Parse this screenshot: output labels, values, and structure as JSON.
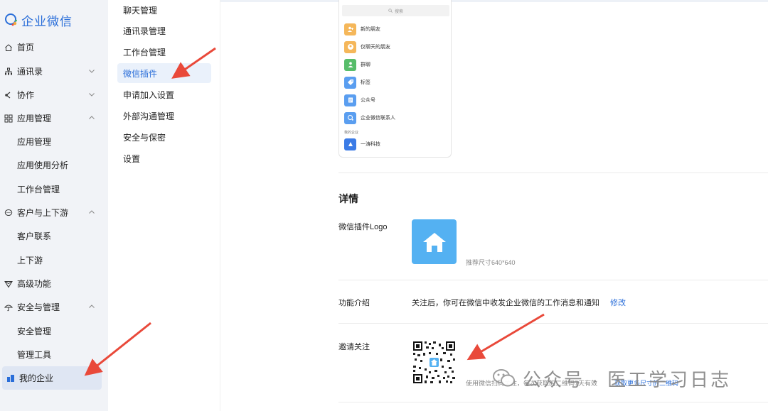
{
  "sidebar": {
    "brand": "企业微信",
    "items": [
      {
        "label": "首页"
      },
      {
        "label": "通讯录"
      },
      {
        "label": "协作"
      },
      {
        "label": "应用管理"
      },
      {
        "label": "应用管理"
      },
      {
        "label": "应用使用分析"
      },
      {
        "label": "工作台管理"
      },
      {
        "label": "客户与上下游"
      },
      {
        "label": "客户联系"
      },
      {
        "label": "上下游"
      },
      {
        "label": "高级功能"
      },
      {
        "label": "安全与管理"
      },
      {
        "label": "安全管理"
      },
      {
        "label": "管理工具"
      },
      {
        "label": "我的企业"
      }
    ]
  },
  "menu": {
    "items": [
      {
        "label": "聊天管理"
      },
      {
        "label": "通讯录管理"
      },
      {
        "label": "工作台管理"
      },
      {
        "label": "微信插件"
      },
      {
        "label": "申请加入设置"
      },
      {
        "label": "外部沟通管理"
      },
      {
        "label": "安全与保密"
      },
      {
        "label": "设置"
      }
    ]
  },
  "preview": {
    "search_placeholder": "搜索",
    "rows": [
      {
        "label": "新的朋友",
        "color": "#f5b75a",
        "icon": "add-friend-icon"
      },
      {
        "label": "仅聊天的朋友",
        "color": "#f5b75a",
        "icon": "chat-friend-icon"
      },
      {
        "label": "群聊",
        "color": "#57bd6a",
        "icon": "group-icon"
      },
      {
        "label": "标签",
        "color": "#5a9ef0",
        "icon": "tag-icon"
      },
      {
        "label": "公众号",
        "color": "#5a9ef0",
        "icon": "official-account-icon"
      },
      {
        "label": "企业微信联系人",
        "color": "#5a9ef0",
        "icon": "wecom-contact-icon"
      }
    ],
    "section_label": "我的企业",
    "company": {
      "label": "一涛科技",
      "color": "#3b7be6"
    }
  },
  "details": {
    "title": "详情",
    "logo_label": "微信插件Logo",
    "logo_hint": "推荐尺寸640*640",
    "intro_label": "功能介绍",
    "intro_text": "关注后，你可在微信中收发企业微信的工作消息和通知",
    "intro_edit": "修改",
    "invite_label": "邀请关注",
    "qr_hint": "使用微信扫码关注，每次获取的二维码7天有效",
    "qr_link": "获取更多尺寸的二维码"
  },
  "watermark": {
    "text": "公众号 · 医工学习日志"
  },
  "colors": {
    "accent": "#2a6ed9",
    "sidebar_bg": "#f1f3f7",
    "annotation_arrow": "#e9493a",
    "logo_bg": "#54b1f2"
  }
}
